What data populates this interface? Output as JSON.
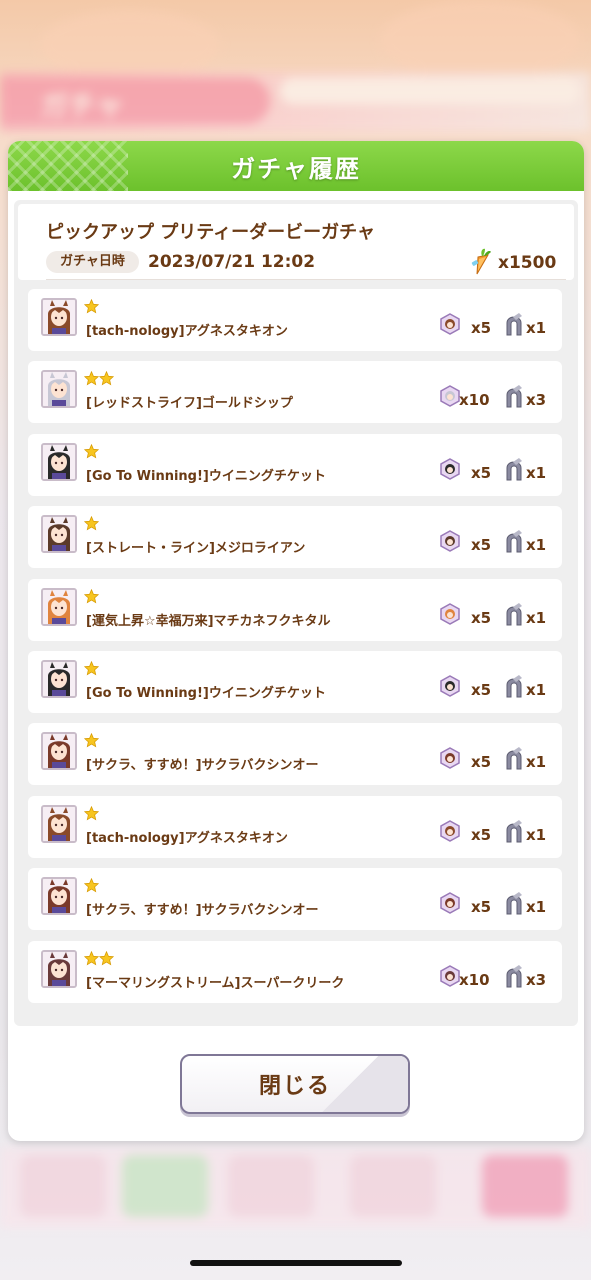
{
  "dialog": {
    "title": "ガチャ履歴"
  },
  "history": {
    "banner_name": "ピックアップ プリティーダービーガチャ",
    "date_label": "ガチャ日時",
    "date_value": "2023/07/21 12:02",
    "cost": "x1500",
    "cost_icon": "carrot-icon"
  },
  "rows": [
    {
      "stars": 1,
      "name": "[tach-nology]アグネスタキオン",
      "pieces": "x5",
      "shoes": "x1",
      "hair": "#8a4a2a"
    },
    {
      "stars": 2,
      "name": "[レッドストライフ]ゴールドシップ",
      "pieces": "x10",
      "shoes": "x3",
      "hair": "#c7c7d4"
    },
    {
      "stars": 1,
      "name": "[Go To Winning!]ウイニングチケット",
      "pieces": "x5",
      "shoes": "x1",
      "hair": "#2a2a2a"
    },
    {
      "stars": 1,
      "name": "[ストレート・ライン]メジロライアン",
      "pieces": "x5",
      "shoes": "x1",
      "hair": "#5b3a2a"
    },
    {
      "stars": 1,
      "name": "[運気上昇☆幸福万来]マチカネフクキタル",
      "pieces": "x5",
      "shoes": "x1",
      "hair": "#e0843e"
    },
    {
      "stars": 1,
      "name": "[Go To Winning!]ウイニングチケット",
      "pieces": "x5",
      "shoes": "x1",
      "hair": "#2a2a2a"
    },
    {
      "stars": 1,
      "name": "[サクラ、すすめ！]サクラバクシンオー",
      "pieces": "x5",
      "shoes": "x1",
      "hair": "#7a3a2a"
    },
    {
      "stars": 1,
      "name": "[tach-nology]アグネスタキオン",
      "pieces": "x5",
      "shoes": "x1",
      "hair": "#8a4a2a"
    },
    {
      "stars": 1,
      "name": "[サクラ、すすめ！]サクラバクシンオー",
      "pieces": "x5",
      "shoes": "x1",
      "hair": "#7a3a2a"
    },
    {
      "stars": 2,
      "name": "[マーマリングストリーム]スーパークリーク",
      "pieces": "x10",
      "shoes": "x3",
      "hair": "#6a3a3a"
    }
  ],
  "close_button": {
    "label": "閉じる"
  },
  "background": {
    "screen_title": "ガチャ"
  },
  "colors": {
    "accent_green": "#6cc12c",
    "text_brown": "#6a3a14",
    "star_gold": "#f7c520"
  }
}
